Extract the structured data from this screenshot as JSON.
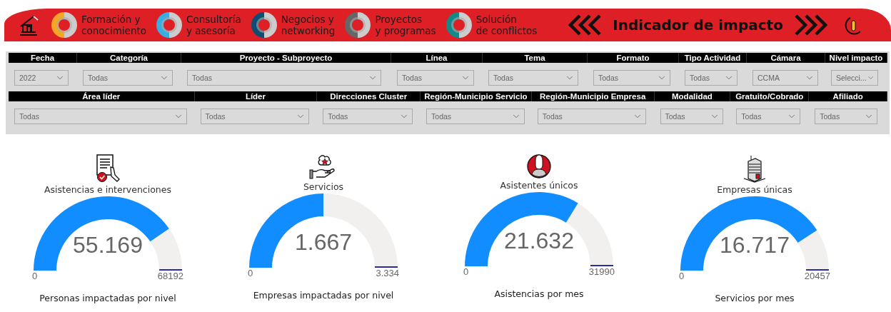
{
  "header": {
    "nav": [
      {
        "label": "Formación y\nconocimiento",
        "color": "#f5a623"
      },
      {
        "label": "Consultoría\ny asesoría",
        "color": "#3aaee0"
      },
      {
        "label": "Negocios y\nnetworking",
        "color": "#0d4f73"
      },
      {
        "label": "Proyectos\ny programas",
        "color": "#666666"
      },
      {
        "label": "Solución\nde conflictos",
        "color": "#138a8a"
      }
    ],
    "title": "Indicador de impacto"
  },
  "filter_rows": [
    [
      {
        "label": "Fecha",
        "value": "2022"
      },
      {
        "label": "Categoría",
        "value": "Todas"
      },
      {
        "label": "Proyecto - Subproyecto",
        "value": "Todas"
      },
      {
        "label": "Línea",
        "value": "Todas"
      },
      {
        "label": "Tema",
        "value": "Todas"
      },
      {
        "label": "Formato",
        "value": "Todas"
      },
      {
        "label": "Tipo Actividad",
        "value": "Todas"
      },
      {
        "label": "Cámara",
        "value": "CCMA"
      },
      {
        "label": "Nivel impacto",
        "value": "Selecci..."
      }
    ],
    [
      {
        "label": "Área líder",
        "value": "Todas"
      },
      {
        "label": "Líder",
        "value": "Todas"
      },
      {
        "label": "Direcciones Cluster",
        "value": "Todas"
      },
      {
        "label": "Región-Municipio Servicio",
        "value": "Todas"
      },
      {
        "label": "Región-Municipio Empresa",
        "value": "Todas"
      },
      {
        "label": "Modalidad",
        "value": "Todas"
      },
      {
        "label": "Gratuito/Cobrado",
        "value": "Todas"
      },
      {
        "label": "Afiliado",
        "value": "Todas"
      }
    ]
  ],
  "gauges": [
    {
      "kind": "document",
      "title": "Asistencias e intervenciones",
      "value": "55.169",
      "min": "0",
      "max": "68192",
      "caption": "Personas impactadas por nivel"
    },
    {
      "kind": "service",
      "title": "Servicios",
      "value": "1.667",
      "min": "0",
      "max": "3.334",
      "caption": "Empresas impactadas por nivel"
    },
    {
      "kind": "person",
      "title": "Asistentes únicos",
      "value": "21.632",
      "min": "0",
      "max": "31990",
      "caption": "Asistencias por mes"
    },
    {
      "kind": "building",
      "title": "Empresas únicas",
      "value": "16.717",
      "min": "0",
      "max": "20457",
      "caption": "Servicios por mes"
    }
  ]
}
